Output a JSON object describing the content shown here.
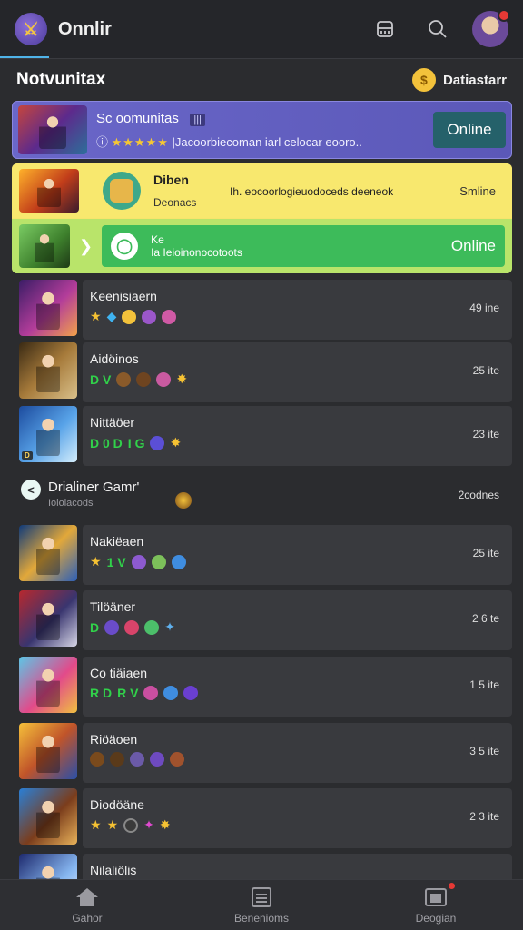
{
  "app": {
    "title": "Onnlir"
  },
  "section": {
    "title": "Notvunitax",
    "action_label": "Datiastarr"
  },
  "featured": {
    "title": "Sc oomunitas",
    "badge": "|||",
    "rating": "★★★★★",
    "subtitle": "|Jacoorbiecoman iarl celocar eooro..",
    "button": "Online"
  },
  "promo": {
    "name": "Diben",
    "desc": "Deonacs",
    "line": "Ih. eocoorlogieuodoceds deeneok",
    "status": "Smline",
    "green_line1": "Ke",
    "green_line2": "Ia Ieioinonocotoots",
    "green_button": "Online"
  },
  "group_header": {
    "title": "Drialiner Gamr'",
    "sub": "Ioloiacods",
    "count": "2codnes"
  },
  "games": [
    {
      "name": "Keenisiaern",
      "count": "49 ine",
      "badges": [
        "star",
        "diamond",
        "coin",
        "orb-purple",
        "orb-pink"
      ]
    },
    {
      "name": "Aidöinos",
      "count": "25 ite",
      "badges": [
        "green:D V",
        "orb-brown",
        "orb-brown",
        "orb-pink",
        "spark"
      ]
    },
    {
      "name": "Nittäöer",
      "count": "23 ite",
      "badges": [
        "green:D 0 D",
        "green:I G",
        "orb-blue",
        "spark"
      ]
    },
    {
      "name": "Nakiëaen",
      "count": "25 ite",
      "badges": [
        "star",
        "green:1 V",
        "orb-purple",
        "orb-green",
        "orb-blue"
      ]
    },
    {
      "name": "Tilöäner",
      "count": "2 6 te",
      "badges": [
        "green:D",
        "orb-purple",
        "orb-red",
        "orb-green",
        "spark-blue"
      ]
    },
    {
      "name": "Co tiäiaen",
      "count": "1 5 ite",
      "badges": [
        "green:R D",
        "green:R V",
        "orb-pink",
        "orb-blue",
        "orb-purple"
      ]
    },
    {
      "name": "Riöäoen",
      "count": "3 5 ite",
      "badges": [
        "orb-brown",
        "orb-brown",
        "orb-purple",
        "orb-purple",
        "orb-brown"
      ]
    },
    {
      "name": "Diodöäne",
      "count": "2 3 ite",
      "badges": [
        "star",
        "star",
        "orb-dark",
        "spark-pink",
        "spark"
      ]
    },
    {
      "name": "Nilaliölis",
      "count": "",
      "badges": []
    }
  ],
  "bottom_nav": [
    {
      "label": "Gahor",
      "icon": "home-icon"
    },
    {
      "label": "Benenioms",
      "icon": "list-icon"
    },
    {
      "label": "Deogian",
      "icon": "card-icon"
    }
  ],
  "colors": {
    "accent": "#4fb3e8",
    "banner": "#6a67c9",
    "promo_yellow": "#f8e86e",
    "promo_green": "#3dbb5a",
    "card": "#393a3e"
  }
}
